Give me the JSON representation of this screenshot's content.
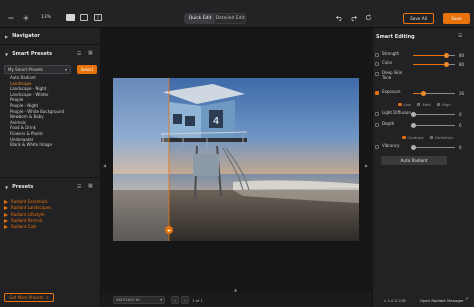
{
  "topbar": {
    "zoom_value": "13%",
    "modes": [
      "Quick Edit",
      "Detailed Edit"
    ],
    "save_all_label": "Save All",
    "save_label": "Save"
  },
  "navigator": {
    "title": "Navigator"
  },
  "smart_presets": {
    "title": "Smart Presets",
    "selected_group": "My Smart Presets",
    "select_label": "Select",
    "items": [
      "Auto Radiant",
      "Landscape",
      "Landscape - Night",
      "Landscape - Winter",
      "People",
      "People - Night",
      "People - White Background",
      "Newborn & Baby",
      "Animals",
      "Food & Drink",
      "Flowers & Plants",
      "Underwater",
      "Black & White Image"
    ],
    "selected_index": 1
  },
  "presets": {
    "title": "Presets",
    "items": [
      "Radiant Essentials",
      "Radiant Landscapes",
      "Radiant Lifestyle",
      "Radiant Portrait",
      "Radiant Cats"
    ],
    "get_more_label": "Get More Presets"
  },
  "canvas": {
    "file_name": "DSCF1007.tif",
    "page_indicator": "1 of 1"
  },
  "smart_editing": {
    "title": "Smart Editing",
    "sliders": [
      {
        "label": "Strength",
        "value": 80,
        "checkbox": false
      },
      {
        "label": "Color",
        "value": 80,
        "checkbox": false
      },
      {
        "label": "Deep Skin Tone",
        "value": null,
        "checkbox": false
      },
      {
        "label": "Exposure",
        "value": 26,
        "checkbox": true
      },
      {
        "label": "Light Diffusion",
        "value": 0,
        "checkbox": false
      },
      {
        "label": "Depth",
        "value": 0,
        "checkbox": false
      },
      {
        "label": "Vibrancy",
        "value": 0,
        "checkbox": false
      }
    ],
    "exposure_modes": [
      "Low",
      "Med",
      "High"
    ],
    "exposure_mode_selected": 0,
    "depth_modes": [
      "Contrast",
      "Definition"
    ],
    "depth_mode_selected": 0,
    "auto_radiant_label": "Auto Radiant",
    "version": "v 1.0.0.218",
    "manager_label": "Open Radiant Manager"
  },
  "colors": {
    "accent": "#e8720c",
    "panel": "#222224",
    "canvas": "#161617"
  }
}
